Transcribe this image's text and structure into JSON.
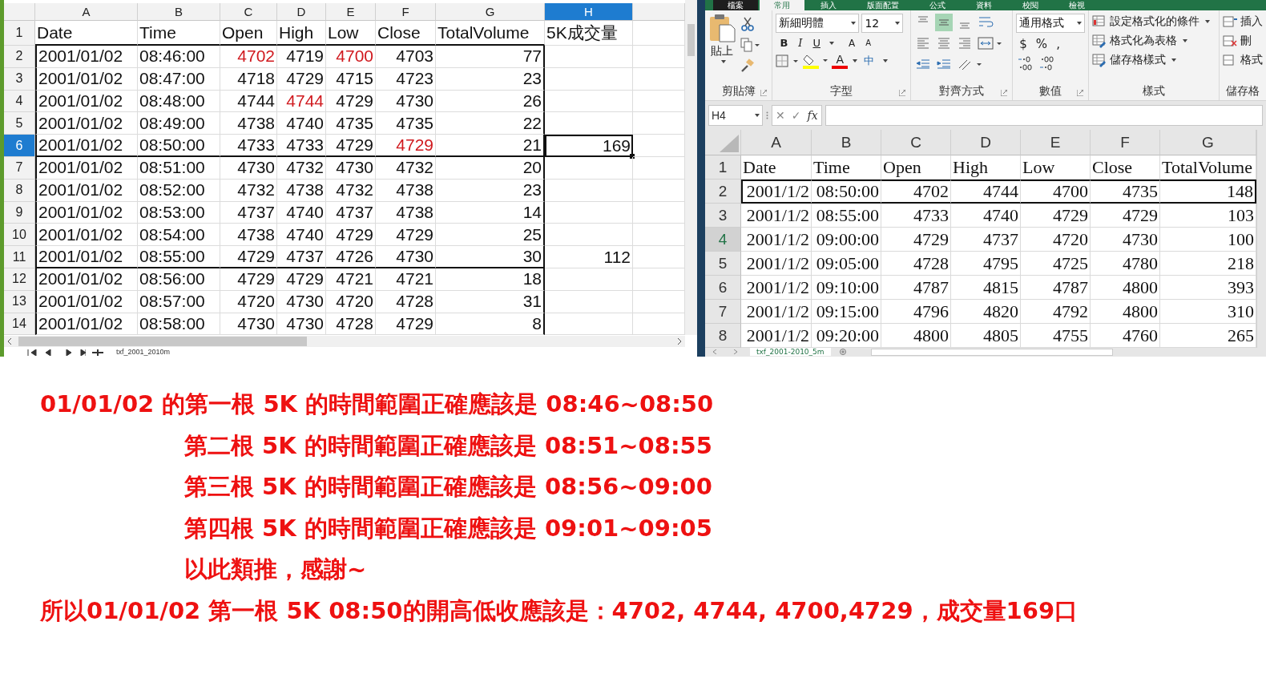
{
  "left_sheet": {
    "columns": [
      {
        "label": "A",
        "selected": false
      },
      {
        "label": "B",
        "selected": false
      },
      {
        "label": "C",
        "selected": false
      },
      {
        "label": "D",
        "selected": false
      },
      {
        "label": "E",
        "selected": false
      },
      {
        "label": "F",
        "selected": false
      },
      {
        "label": "G",
        "selected": false
      },
      {
        "label": "H",
        "selected": true
      }
    ],
    "rows": [
      {
        "number": "1",
        "selected": false,
        "border_below": true,
        "cells": [
          {
            "text": "Date",
            "red": false
          },
          {
            "text": "Time",
            "red": false
          },
          {
            "text": "Open",
            "red": false
          },
          {
            "text": "High",
            "red": false
          },
          {
            "text": "Low",
            "red": false
          },
          {
            "text": "Close",
            "red": false
          },
          {
            "text": "TotalVolume",
            "red": false
          },
          {
            "text": "5K成交量",
            "red": false
          }
        ]
      },
      {
        "number": "2",
        "selected": false,
        "border_below": false,
        "cells": [
          {
            "text": "2001/01/02",
            "red": false
          },
          {
            "text": "08:46:00",
            "red": false
          },
          {
            "text": "4702",
            "red": true
          },
          {
            "text": "4719",
            "red": false
          },
          {
            "text": "4700",
            "red": true
          },
          {
            "text": "4703",
            "red": false
          },
          {
            "text": "77",
            "red": false
          },
          {
            "text": "",
            "red": false
          }
        ]
      },
      {
        "number": "3",
        "selected": false,
        "border_below": false,
        "cells": [
          {
            "text": "2001/01/02",
            "red": false
          },
          {
            "text": "08:47:00",
            "red": false
          },
          {
            "text": "4718",
            "red": false
          },
          {
            "text": "4729",
            "red": false
          },
          {
            "text": "4715",
            "red": false
          },
          {
            "text": "4723",
            "red": false
          },
          {
            "text": "23",
            "red": false
          },
          {
            "text": "",
            "red": false
          }
        ]
      },
      {
        "number": "4",
        "selected": false,
        "border_below": false,
        "cells": [
          {
            "text": "2001/01/02",
            "red": false
          },
          {
            "text": "08:48:00",
            "red": false
          },
          {
            "text": "4744",
            "red": false
          },
          {
            "text": "4744",
            "red": true
          },
          {
            "text": "4729",
            "red": false
          },
          {
            "text": "4730",
            "red": false
          },
          {
            "text": "26",
            "red": false
          },
          {
            "text": "",
            "red": false
          }
        ]
      },
      {
        "number": "5",
        "selected": false,
        "border_below": false,
        "cells": [
          {
            "text": "2001/01/02",
            "red": false
          },
          {
            "text": "08:49:00",
            "red": false
          },
          {
            "text": "4738",
            "red": false
          },
          {
            "text": "4740",
            "red": false
          },
          {
            "text": "4735",
            "red": false
          },
          {
            "text": "4735",
            "red": false
          },
          {
            "text": "22",
            "red": false
          },
          {
            "text": "",
            "red": false
          }
        ]
      },
      {
        "number": "6",
        "selected": true,
        "border_below": true,
        "cells": [
          {
            "text": "2001/01/02",
            "red": false
          },
          {
            "text": "08:50:00",
            "red": false
          },
          {
            "text": "4733",
            "red": false
          },
          {
            "text": "4733",
            "red": false
          },
          {
            "text": "4729",
            "red": false
          },
          {
            "text": "4729",
            "red": true
          },
          {
            "text": "21",
            "red": false
          },
          {
            "text": "169",
            "red": false
          }
        ]
      },
      {
        "number": "7",
        "selected": false,
        "border_below": false,
        "cells": [
          {
            "text": "2001/01/02",
            "red": false
          },
          {
            "text": "08:51:00",
            "red": false
          },
          {
            "text": "4730",
            "red": false
          },
          {
            "text": "4732",
            "red": false
          },
          {
            "text": "4730",
            "red": false
          },
          {
            "text": "4732",
            "red": false
          },
          {
            "text": "20",
            "red": false
          },
          {
            "text": "",
            "red": false
          }
        ]
      },
      {
        "number": "8",
        "selected": false,
        "border_below": false,
        "cells": [
          {
            "text": "2001/01/02",
            "red": false
          },
          {
            "text": "08:52:00",
            "red": false
          },
          {
            "text": "4732",
            "red": false
          },
          {
            "text": "4738",
            "red": false
          },
          {
            "text": "4732",
            "red": false
          },
          {
            "text": "4738",
            "red": false
          },
          {
            "text": "23",
            "red": false
          },
          {
            "text": "",
            "red": false
          }
        ]
      },
      {
        "number": "9",
        "selected": false,
        "border_below": false,
        "cells": [
          {
            "text": "2001/01/02",
            "red": false
          },
          {
            "text": "08:53:00",
            "red": false
          },
          {
            "text": "4737",
            "red": false
          },
          {
            "text": "4740",
            "red": false
          },
          {
            "text": "4737",
            "red": false
          },
          {
            "text": "4738",
            "red": false
          },
          {
            "text": "14",
            "red": false
          },
          {
            "text": "",
            "red": false
          }
        ]
      },
      {
        "number": "10",
        "selected": false,
        "border_below": false,
        "cells": [
          {
            "text": "2001/01/02",
            "red": false
          },
          {
            "text": "08:54:00",
            "red": false
          },
          {
            "text": "4738",
            "red": false
          },
          {
            "text": "4740",
            "red": false
          },
          {
            "text": "4729",
            "red": false
          },
          {
            "text": "4729",
            "red": false
          },
          {
            "text": "25",
            "red": false
          },
          {
            "text": "",
            "red": false
          }
        ]
      },
      {
        "number": "11",
        "selected": false,
        "border_below": true,
        "cells": [
          {
            "text": "2001/01/02",
            "red": false
          },
          {
            "text": "08:55:00",
            "red": false
          },
          {
            "text": "4729",
            "red": false
          },
          {
            "text": "4737",
            "red": false
          },
          {
            "text": "4726",
            "red": false
          },
          {
            "text": "4730",
            "red": false
          },
          {
            "text": "30",
            "red": false
          },
          {
            "text": "112",
            "red": false
          }
        ]
      },
      {
        "number": "12",
        "selected": false,
        "border_below": false,
        "cells": [
          {
            "text": "2001/01/02",
            "red": false
          },
          {
            "text": "08:56:00",
            "red": false
          },
          {
            "text": "4729",
            "red": false
          },
          {
            "text": "4729",
            "red": false
          },
          {
            "text": "4721",
            "red": false
          },
          {
            "text": "4721",
            "red": false
          },
          {
            "text": "18",
            "red": false
          },
          {
            "text": "",
            "red": false
          }
        ]
      },
      {
        "number": "13",
        "selected": false,
        "border_below": false,
        "cells": [
          {
            "text": "2001/01/02",
            "red": false
          },
          {
            "text": "08:57:00",
            "red": false
          },
          {
            "text": "4720",
            "red": false
          },
          {
            "text": "4730",
            "red": false
          },
          {
            "text": "4720",
            "red": false
          },
          {
            "text": "4728",
            "red": false
          },
          {
            "text": "31",
            "red": false
          },
          {
            "text": "",
            "red": false
          }
        ]
      },
      {
        "number": "14",
        "selected": false,
        "border_below": false,
        "cells": [
          {
            "text": "2001/01/02",
            "red": false
          },
          {
            "text": "08:58:00",
            "red": false
          },
          {
            "text": "4730",
            "red": false
          },
          {
            "text": "4730",
            "red": false
          },
          {
            "text": "4728",
            "red": false
          },
          {
            "text": "4729",
            "red": false
          },
          {
            "text": "8",
            "red": false
          },
          {
            "text": "",
            "red": false
          }
        ]
      }
    ],
    "sheet_tab": "txf_2001_2010m"
  },
  "ribbon": {
    "tabs": [
      {
        "label": "檔案",
        "kind": "file",
        "selected": false
      },
      {
        "label": "常用",
        "kind": "tab",
        "selected": true
      },
      {
        "label": "插入",
        "kind": "tab",
        "selected": false
      },
      {
        "label": "版面配置",
        "kind": "tab",
        "selected": false
      },
      {
        "label": "公式",
        "kind": "tab",
        "selected": false
      },
      {
        "label": "資料",
        "kind": "tab",
        "selected": false
      },
      {
        "label": "校閱",
        "kind": "tab",
        "selected": false
      },
      {
        "label": "檢視",
        "kind": "tab",
        "selected": false
      }
    ],
    "clipboard": {
      "paste": "貼上",
      "label": "剪貼簿"
    },
    "font": {
      "name": "新細明體",
      "size": "12",
      "styles": [
        "B",
        "I",
        "U"
      ],
      "size_buttons": [
        "A",
        "A"
      ],
      "color_button": "A",
      "phonetic_button": "中",
      "label": "字型"
    },
    "alignment": {
      "label": "對齊方式"
    },
    "number": {
      "format": "通用格式",
      "symbols": [
        "$",
        "%",
        ","
      ],
      "label": "數值"
    },
    "styles": {
      "items": [
        "設定格式化的條件",
        "格式化為表格",
        "儲存格樣式"
      ],
      "label": "樣式"
    },
    "cells": {
      "items": [
        "插入",
        "刪",
        "格式"
      ],
      "label": "儲存格"
    }
  },
  "formula_bar": {
    "name_box": "H4",
    "buttons": [
      "✕",
      "✓",
      "fx"
    ]
  },
  "right_sheet": {
    "columns": [
      "A",
      "B",
      "C",
      "D",
      "E",
      "F",
      "G"
    ],
    "rows": [
      {
        "number": "1",
        "selected": false,
        "boxed": false,
        "cells": [
          "Date",
          "Time",
          "Open",
          "High",
          "Low",
          "Close",
          "TotalVolume"
        ]
      },
      {
        "number": "2",
        "selected": false,
        "boxed": true,
        "cells": [
          "2001/1/2",
          "08:50:00",
          "4702",
          "4744",
          "4700",
          "4735",
          "148"
        ]
      },
      {
        "number": "3",
        "selected": false,
        "boxed": false,
        "cells": [
          "2001/1/2",
          "08:55:00",
          "4733",
          "4740",
          "4729",
          "4729",
          "103"
        ]
      },
      {
        "number": "4",
        "selected": true,
        "boxed": false,
        "cells": [
          "2001/1/2",
          "09:00:00",
          "4729",
          "4737",
          "4720",
          "4730",
          "100"
        ]
      },
      {
        "number": "5",
        "selected": false,
        "boxed": false,
        "cells": [
          "2001/1/2",
          "09:05:00",
          "4728",
          "4795",
          "4725",
          "4780",
          "218"
        ]
      },
      {
        "number": "6",
        "selected": false,
        "boxed": false,
        "cells": [
          "2001/1/2",
          "09:10:00",
          "4787",
          "4815",
          "4787",
          "4800",
          "393"
        ]
      },
      {
        "number": "7",
        "selected": false,
        "boxed": false,
        "cells": [
          "2001/1/2",
          "09:15:00",
          "4796",
          "4820",
          "4792",
          "4800",
          "310"
        ]
      },
      {
        "number": "8",
        "selected": false,
        "boxed": false,
        "cells": [
          "2001/1/2",
          "09:20:00",
          "4800",
          "4805",
          "4755",
          "4760",
          "265"
        ]
      }
    ],
    "sheet_tab": "txf_2001-2010_5m"
  },
  "message": [
    {
      "kind": "lead",
      "text": "01/01/02 的第一根 5K 的時間範圍正確應該是 08:46~08:50"
    },
    {
      "kind": "indented",
      "text": "第二根 5K 的時間範圍正確應該是 08:51~08:55"
    },
    {
      "kind": "indented",
      "text": "第三根 5K 的時間範圍正確應該是 08:56~09:00"
    },
    {
      "kind": "indented",
      "text": "第四根 5K 的時間範圍正確應該是 09:01~09:05"
    },
    {
      "kind": "indented",
      "text": "以此類推，感謝~"
    },
    {
      "kind": "lead",
      "text": "所以01/01/02 第一根 5K 08:50的開高低收應該是：4702, 4744, 4700,4729，成交量169口"
    }
  ]
}
